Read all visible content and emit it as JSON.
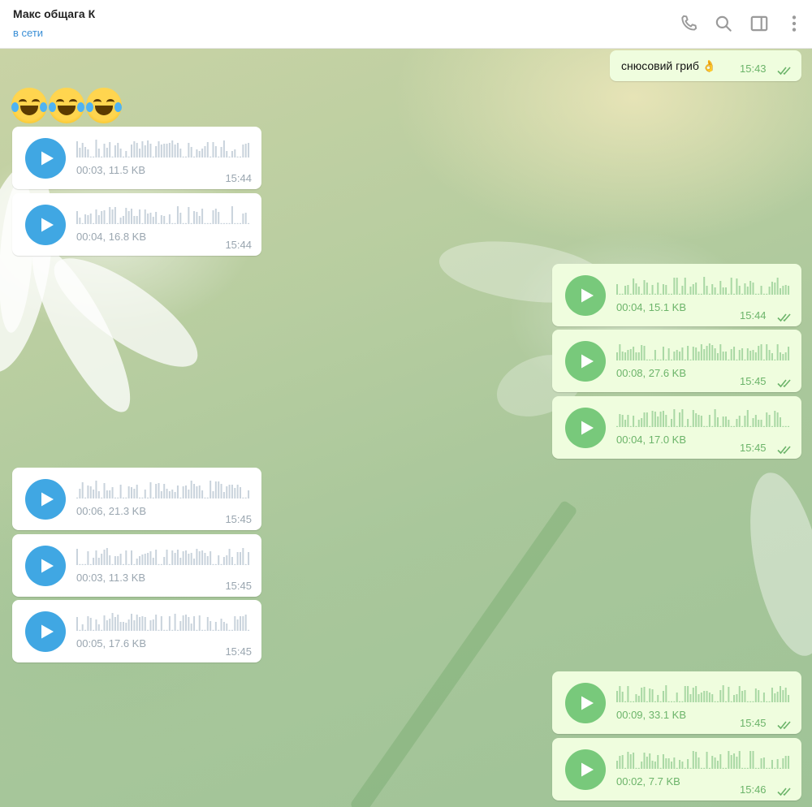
{
  "header": {
    "title": "Макс общага К",
    "status": "в сети",
    "icons": [
      "phone-icon",
      "search-icon",
      "sidebar-toggle-icon",
      "more-vertical-icon"
    ]
  },
  "colors": {
    "incoming_accent": "#40a7e3",
    "outgoing_accent": "#78c97b",
    "outgoing_bubble": "#effdde",
    "status_blue": "#3a8fd6"
  },
  "messages": [
    {
      "dir": "out",
      "kind": "text",
      "text": "снюсовий гриб 👌",
      "time": "15:43",
      "read": true
    },
    {
      "dir": "in",
      "kind": "emoji",
      "emoji_name": "face-with-tears-of-joy-icon",
      "count": 3
    },
    {
      "dir": "in",
      "kind": "voice",
      "meta": "00:03, 11.5 KB",
      "time": "15:44"
    },
    {
      "dir": "in",
      "kind": "voice",
      "meta": "00:04, 16.8 KB",
      "time": "15:44"
    },
    {
      "dir": "out",
      "kind": "voice",
      "meta": "00:04, 15.1 KB",
      "time": "15:44",
      "read": true
    },
    {
      "dir": "out",
      "kind": "voice",
      "meta": "00:08, 27.6 KB",
      "time": "15:45",
      "read": true
    },
    {
      "dir": "out",
      "kind": "voice",
      "meta": "00:04, 17.0 KB",
      "time": "15:45",
      "read": true
    },
    {
      "dir": "in",
      "kind": "voice",
      "meta": "00:06, 21.3 KB",
      "time": "15:45"
    },
    {
      "dir": "in",
      "kind": "voice",
      "meta": "00:03, 11.3 KB",
      "time": "15:45"
    },
    {
      "dir": "in",
      "kind": "voice",
      "meta": "00:05, 17.6 KB",
      "time": "15:45"
    },
    {
      "dir": "out",
      "kind": "voice",
      "meta": "00:09, 33.1 KB",
      "time": "15:45",
      "read": true
    },
    {
      "dir": "out",
      "kind": "voice",
      "meta": "00:02, 7.7 KB",
      "time": "15:46",
      "read": true
    }
  ]
}
